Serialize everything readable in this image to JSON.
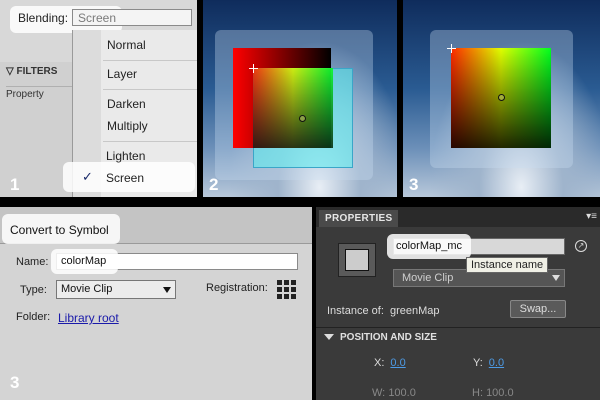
{
  "panel1": {
    "step": "1",
    "blending_label": "Blending:",
    "blending_value": "Screen",
    "filters_label": "FILTERS",
    "property_label": "Property",
    "menu_items": [
      "Normal",
      "Layer",
      "Darken",
      "Multiply",
      "Lighten",
      "Screen"
    ],
    "selected_item": "Screen",
    "check_glyph": "✓"
  },
  "panel2": {
    "step": "2"
  },
  "panel3": {
    "step": "3"
  },
  "convert": {
    "step": "3",
    "title": "Convert to Symbol",
    "name_label": "Name:",
    "name_value": "colorMap",
    "type_label": "Type:",
    "type_value": "Movie Clip",
    "registration_label": "Registration:",
    "folder_label": "Folder:",
    "folder_link": "Library root"
  },
  "properties": {
    "tab": "PROPERTIES",
    "instance_name_value": "colorMap_mc",
    "tooltip": "Instance name",
    "symbol_type": "Movie Clip",
    "instance_of_label": "Instance of:",
    "instance_of_value": "greenMap",
    "swap_button": "Swap...",
    "section_title": "POSITION AND SIZE",
    "x_label": "X:",
    "x_value": "0.0",
    "y_label": "Y:",
    "y_value": "0.0",
    "w_label": "W:",
    "w_value": "100.0",
    "h_label": "H:",
    "h_value": "100.0"
  },
  "colors": {
    "highlight": "#ffffff",
    "link_blue": "#1a1aaa",
    "prop_value_blue": "#4d9be6",
    "properties_bg": "#3a3a3a"
  }
}
